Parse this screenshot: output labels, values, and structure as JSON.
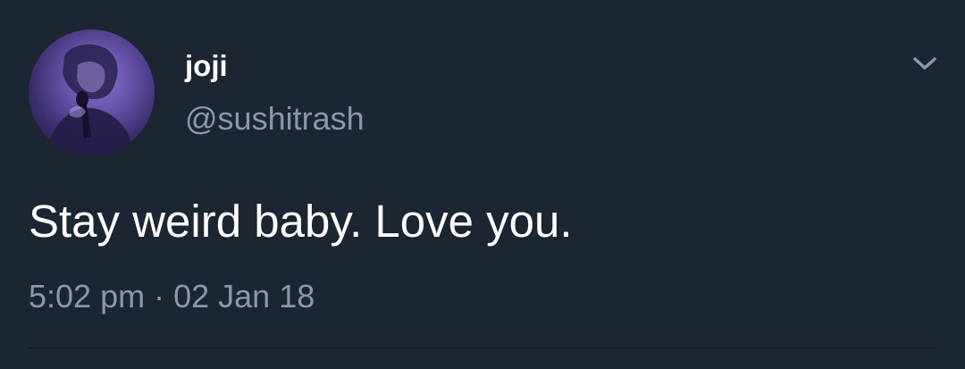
{
  "user": {
    "display_name": "joji",
    "handle": "@sushitrash"
  },
  "tweet": {
    "text": "Stay weird baby. Love you.",
    "time": "5:02 pm",
    "separator": "·",
    "date": "02 Jan 18"
  },
  "icons": {
    "avatar": "profile-photo",
    "menu": "chevron-down-icon"
  },
  "colors": {
    "background": "#1c2532",
    "primary_text": "#ffffff",
    "secondary_text": "#8899a6",
    "avatar_tint": "#6a55ad"
  }
}
